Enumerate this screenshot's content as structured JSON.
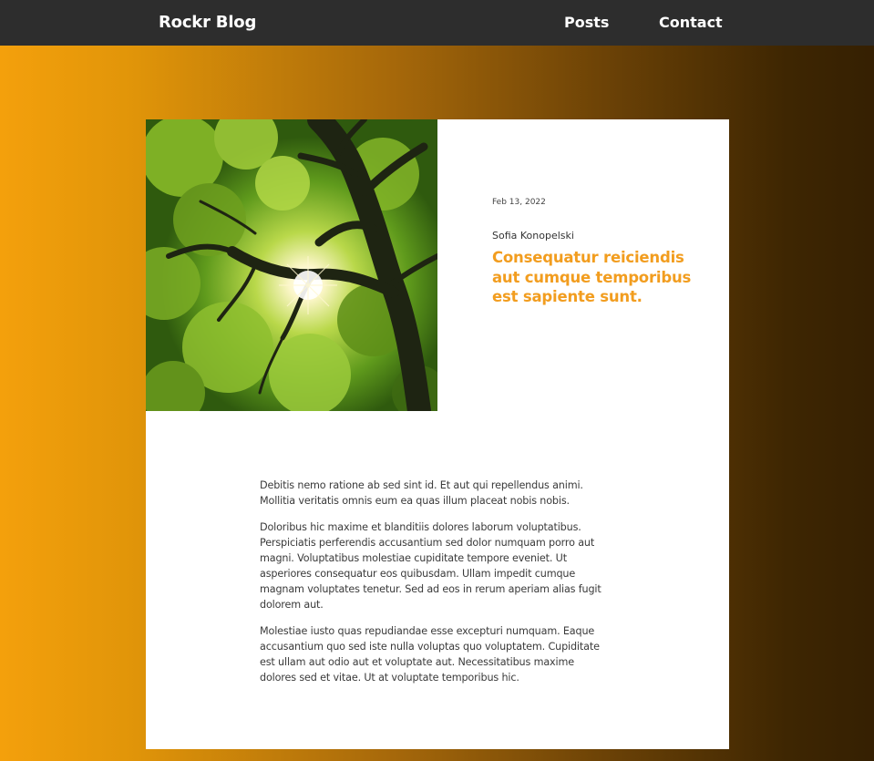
{
  "nav": {
    "brand": "Rockr Blog",
    "links": [
      "Posts",
      "Contact"
    ]
  },
  "post": {
    "image_alt": "Sunlight shining through a tree canopy",
    "date": "Feb 13, 2022",
    "author": "Sofia Konopelski",
    "title": "Consequatur reiciendis aut cumque temporibus est sapiente sunt.",
    "paragraphs": [
      "Debitis nemo ratione ab sed sint id. Et aut qui repellendus animi. Mollitia veritatis omnis eum ea quas illum placeat nobis nobis.",
      "Doloribus hic maxime et blanditiis dolores laborum voluptatibus. Perspiciatis perferendis accusantium sed dolor numquam porro aut magni. Voluptatibus molestiae cupiditate tempore eveniet. Ut asperiores consequatur eos quibusdam. Ullam impedit cumque magnam voluptates tenetur. Sed ad eos in rerum aperiam alias fugit dolorem aut.",
      "Molestiae iusto quas repudiandae esse excepturi numquam. Eaque accusantium quo sed iste nulla voluptas quo voluptatem. Cupiditate est ullam aut odio aut et voluptate aut. Necessitatibus maxime dolores sed et vitae. Ut at voluptate temporibus hic."
    ]
  },
  "colors": {
    "nav_background": "#2d2d2d",
    "accent": "#f29d1f",
    "gradient_start": "#f4a00c",
    "gradient_end": "#352002"
  }
}
